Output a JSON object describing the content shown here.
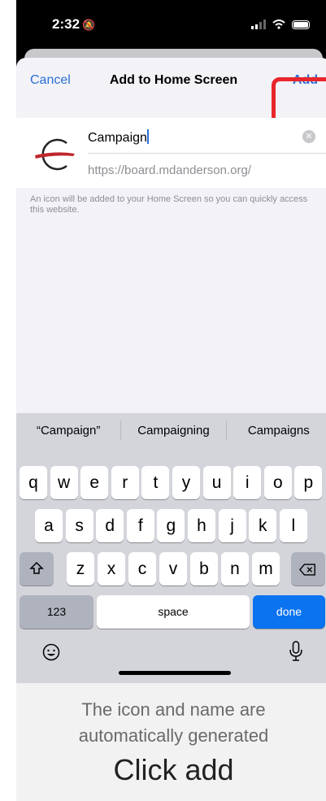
{
  "status_bar": {
    "time": "2:32"
  },
  "nav": {
    "cancel_label": "Cancel",
    "title": "Add to Home Screen",
    "add_label": "Add"
  },
  "form": {
    "name_value": "Campaign",
    "url": "https://board.mdanderson.org/",
    "note": "An icon will be added to your Home Screen so you can quickly access this website."
  },
  "keyboard": {
    "suggestions": [
      "“Campaign”",
      "Campaigning",
      "Campaigns"
    ],
    "row1": [
      "q",
      "w",
      "e",
      "r",
      "t",
      "y",
      "u",
      "i",
      "o",
      "p"
    ],
    "row2": [
      "a",
      "s",
      "d",
      "f",
      "g",
      "h",
      "j",
      "k",
      "l"
    ],
    "row3": [
      "z",
      "x",
      "c",
      "v",
      "b",
      "n",
      "m"
    ],
    "numbers_label": "123",
    "space_label": "space",
    "done_label": "done"
  },
  "caption": {
    "line1": "The icon and name are",
    "line2": "automatically generated",
    "line3": "Click add"
  },
  "colors": {
    "accent": "#2c6fd6",
    "highlight": "#e8262c",
    "done_key": "#0a73f0"
  }
}
